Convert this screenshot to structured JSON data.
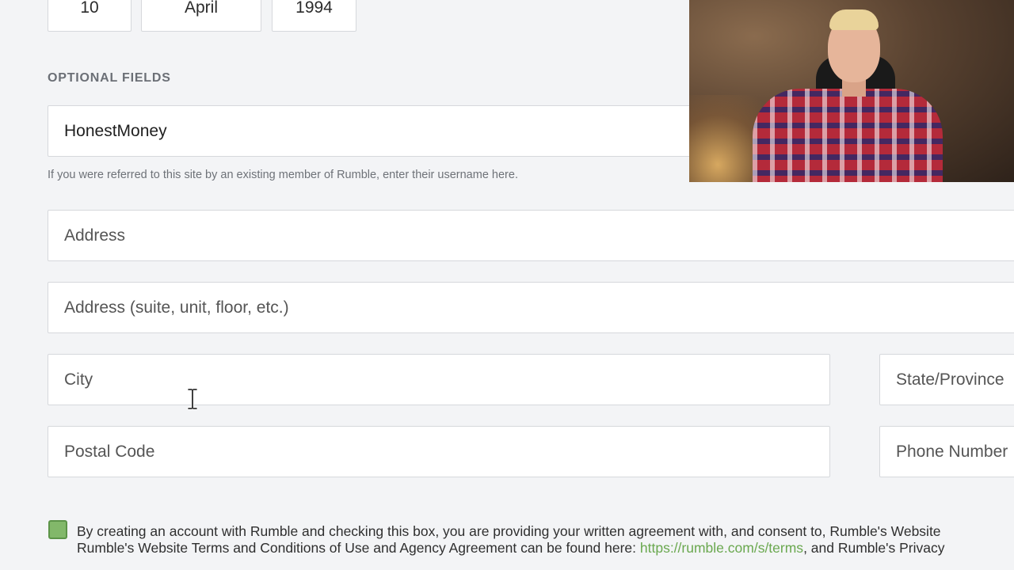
{
  "date_of_birth": {
    "day": "10",
    "month": "April",
    "year": "1994"
  },
  "optional_section": {
    "label": "OPTIONAL FIELDS",
    "referral_value": "HonestMoney",
    "referral_helper": "If you were referred to this site by an existing member of Rumble, enter their username here."
  },
  "address_fields": {
    "address_placeholder": "Address",
    "address2_placeholder": "Address (suite, unit, floor, etc.)",
    "city_placeholder": "City",
    "state_placeholder": "State/Province",
    "postal_placeholder": "Postal Code",
    "phone_placeholder": "Phone Number"
  },
  "consent": {
    "line1": "By creating an account with Rumble and checking this box, you are providing your written agreement with, and consent to, Rumble's Website",
    "line2_start": "Rumble's Website Terms and Conditions of Use and Agency Agreement can be found here: ",
    "link": "https://rumble.com/s/terms",
    "line2_end": ", and Rumble's Privacy"
  },
  "colors": {
    "background": "#f3f4f6",
    "checkbox": "#82b86a",
    "link": "#6aa84f"
  }
}
